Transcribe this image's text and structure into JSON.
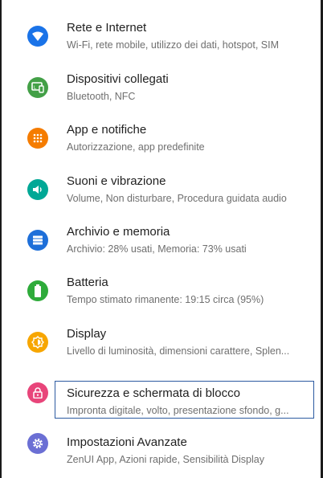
{
  "settings": {
    "items": [
      {
        "title": "Rete e Internet",
        "subtitle": "Wi-Fi, rete mobile, utilizzo dei dati, hotspot, SIM",
        "icon": "wifi-icon",
        "color": "#1a73e8"
      },
      {
        "title": "Dispositivi collegati",
        "subtitle": "Bluetooth, NFC",
        "icon": "connected-devices-icon",
        "color": "#43a047"
      },
      {
        "title": "App e notifiche",
        "subtitle": "Autorizzazione, app predefinite",
        "icon": "apps-grid-icon",
        "color": "#f57c00"
      },
      {
        "title": "Suoni e vibrazione",
        "subtitle": "Volume, Non disturbare, Procedura guidata audio",
        "icon": "volume-icon",
        "color": "#00a896"
      },
      {
        "title": "Archivio e memoria",
        "subtitle": "Archivio: 28% usati, Memoria: 73% usati",
        "icon": "storage-icon",
        "color": "#1e6fd9"
      },
      {
        "title": "Batteria",
        "subtitle": "Tempo stimato rimanente: 19:15 circa (95%)",
        "icon": "battery-icon",
        "color": "#2eab3a"
      },
      {
        "title": "Display",
        "subtitle": "Livello di luminosità, dimensioni carattere, Splen...",
        "icon": "brightness-icon",
        "color": "#f7a600"
      },
      {
        "title": "Sicurezza e schermata di blocco",
        "subtitle": "Impronta digitale, volto, presentazione sfondo, g...",
        "icon": "lock-icon",
        "color": "#e8457a",
        "focused": true
      },
      {
        "title": "Impostazioni Avanzate",
        "subtitle": "ZenUI App, Azioni rapide, Sensibilità Display",
        "icon": "gear-icon",
        "color": "#6b6fd4"
      }
    ]
  }
}
